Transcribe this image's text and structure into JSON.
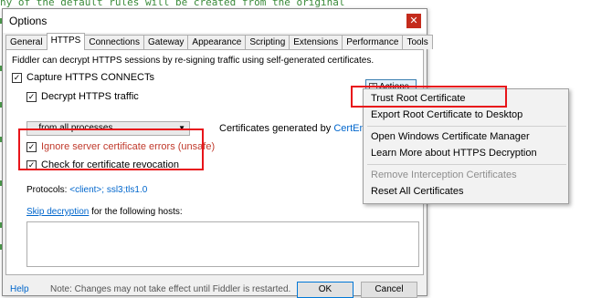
{
  "background": {
    "code_line": "ny of the default rules will be created from the original"
  },
  "dialog": {
    "title": "Options",
    "close_glyph": "✕"
  },
  "tabs": [
    "General",
    "HTTPS",
    "Connections",
    "Gateway",
    "Appearance",
    "Scripting",
    "Extensions",
    "Performance",
    "Tools"
  ],
  "active_tab": "HTTPS",
  "https": {
    "intro": "Fiddler can decrypt HTTPS sessions by re-signing traffic using self-generated certificates.",
    "capture": {
      "label": "Capture HTTPS CONNECTs",
      "checked": true
    },
    "decrypt": {
      "label": "Decrypt HTTPS traffic",
      "checked": true
    },
    "process_select": "...from all processes",
    "certs_prefix": "Certificates generated by",
    "certs_link": "CertEnroll e",
    "ignore_errors": {
      "label": "Ignore server certificate errors (unsafe)",
      "checked": true
    },
    "check_revocation": {
      "label": "Check for certificate revocation",
      "checked": true
    },
    "protocols_label": "Protocols:",
    "protocols_value": "<client>; ssl3;tls1.0",
    "skip_decryption_link": "Skip decryption",
    "skip_decryption_rest": "for the following hosts:",
    "actions_label": "Actions"
  },
  "footer": {
    "help": "Help",
    "note": "Note: Changes may not take effect until Fiddler is restarted.",
    "ok": "OK",
    "cancel": "Cancel"
  },
  "actions_menu": {
    "items": [
      {
        "label": "Trust Root Certificate",
        "enabled": true
      },
      {
        "label": "Export Root Certificate to Desktop",
        "enabled": true
      },
      {
        "label": "Open Windows Certificate Manager",
        "enabled": true
      },
      {
        "label": "Learn More about HTTPS Decryption",
        "enabled": true
      },
      {
        "label": "Remove Interception Certificates",
        "enabled": false
      },
      {
        "label": "Reset All Certificates",
        "enabled": true
      }
    ]
  },
  "colors": {
    "highlight_red": "#e8141a",
    "link_blue": "#0066cc",
    "warning_red": "#c0392b",
    "code_green": "#3a8a3a"
  }
}
